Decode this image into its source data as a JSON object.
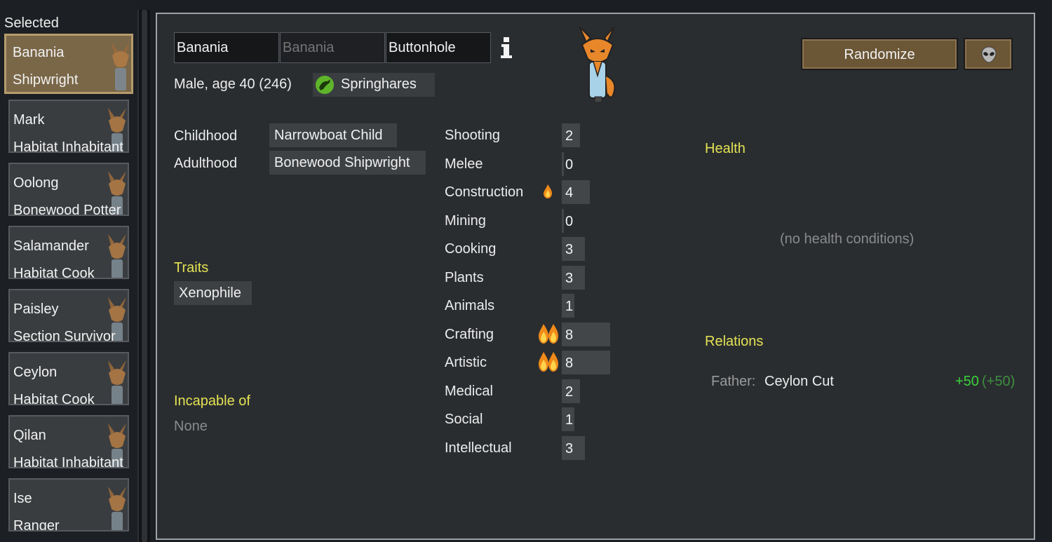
{
  "sidebar": {
    "title": "Selected",
    "pawns": [
      {
        "name": "Banania",
        "job": "Shipwright",
        "selected": true
      },
      {
        "name": "Mark",
        "job": "Habitat Inhabitant"
      },
      {
        "name": "Oolong",
        "job": "Bonewood Potter"
      },
      {
        "name": "Salamander",
        "job": "Habitat Cook"
      },
      {
        "name": "Paisley",
        "job": "Section Survivor"
      },
      {
        "name": "Ceylon",
        "job": "Habitat Cook"
      },
      {
        "name": "Qilan",
        "job": "Habitat Inhabitant"
      },
      {
        "name": "Ise",
        "job": "Ranger"
      }
    ]
  },
  "character": {
    "first_name": "Banania",
    "nickname_placeholder": "Banania",
    "last_name": "Buttonhole",
    "summary": "Male, age 40 (246)",
    "faction": "Springhares",
    "childhood_label": "Childhood",
    "childhood": "Narrowboat Child",
    "adulthood_label": "Adulthood",
    "adulthood": "Bonewood Shipwright",
    "traits_title": "Traits",
    "traits": [
      "Xenophile"
    ],
    "incapable_title": "Incapable of",
    "incapable": "None"
  },
  "buttons": {
    "randomize": "Randomize",
    "xenotype_icon": "alien-head-icon"
  },
  "skills": [
    {
      "name": "Shooting",
      "level": 2,
      "passion": 0
    },
    {
      "name": "Melee",
      "level": 0,
      "passion": 0
    },
    {
      "name": "Construction",
      "level": 4,
      "passion": 1
    },
    {
      "name": "Mining",
      "level": 0,
      "passion": 0
    },
    {
      "name": "Cooking",
      "level": 3,
      "passion": 0
    },
    {
      "name": "Plants",
      "level": 3,
      "passion": 0
    },
    {
      "name": "Animals",
      "level": 1,
      "passion": 0
    },
    {
      "name": "Crafting",
      "level": 8,
      "passion": 2
    },
    {
      "name": "Artistic",
      "level": 8,
      "passion": 2
    },
    {
      "name": "Medical",
      "level": 2,
      "passion": 0
    },
    {
      "name": "Social",
      "level": 1,
      "passion": 0
    },
    {
      "name": "Intellectual",
      "level": 3,
      "passion": 0
    }
  ],
  "health": {
    "title": "Health",
    "empty": "(no health conditions)"
  },
  "relations": {
    "title": "Relations",
    "items": [
      {
        "kind": "Father:",
        "name": "Ceylon Cut",
        "opinion": "+50",
        "opinion_paren": "(+50)"
      }
    ]
  },
  "colors": {
    "accent_yellow": "#e4e354",
    "selected_pawn": "#7a6748",
    "button_brown": "#6b5636",
    "positive_opinion": "#3bd23b"
  }
}
